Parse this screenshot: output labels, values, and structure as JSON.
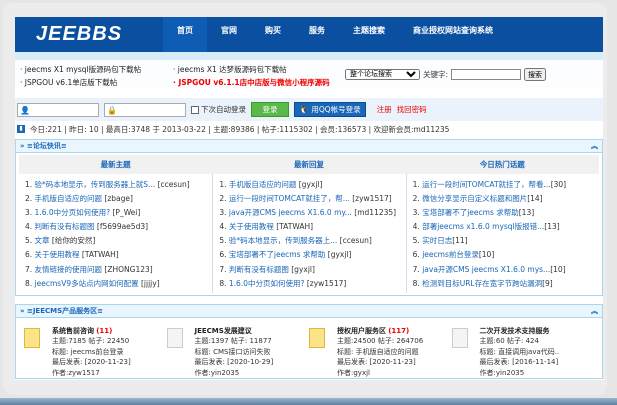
{
  "header": {
    "logo": "JEEBBS",
    "nav": [
      "首页",
      "官网",
      "购买",
      "服务",
      "主题搜索",
      "商业授权网站查询系统"
    ]
  },
  "links": [
    "jeecms X1 mysql版源码包下载帖",
    "JSPGOU v6.1单店版下载帖",
    "jeecms X1 达梦版源码包下载帖",
    "JSPGOU v6.1.1店中店版与微信小程序源码"
  ],
  "search": {
    "scope": "整个论坛搜索",
    "keyword_label": "关键字:",
    "keyword_value": "",
    "button": "搜索"
  },
  "login": {
    "auto_login": "下次自动登录",
    "login_button": "登录",
    "qq_button": "用QQ帐号登录",
    "register": "注册",
    "forgot": "找回密码"
  },
  "stats": "今日:221 | 昨日: 10 | 最高日:3748 于 2013-03-22 | 主题:89386 | 帖子:1115302 | 会员:136573 | 欢迎新会员:md11235",
  "news": {
    "title": "» ≡论坛快讯≡",
    "columns": [
      {
        "title": "最新主题",
        "items": [
          {
            "t": "验*码本地显示，传到服务器上就S...",
            "u": " [ccesun]"
          },
          {
            "t": "手机版自适应的问题",
            "u": " [zbage]"
          },
          {
            "t": "1.6.0中分页如何使用?",
            "u": "  [P_Wei]"
          },
          {
            "t": "判断有没有标题图",
            "u": " [f5699ae5d3]"
          },
          {
            "t": "文章",
            "u": " [给你的安然]"
          },
          {
            "t": "关于使用教程",
            "u": " [TATWAH]"
          },
          {
            "t": "友情链接的使用问题",
            "u": " [ZHONG123]"
          },
          {
            "t": "jeecmsV9多站点内网如何配置",
            "u": " [jjjjy]"
          }
        ]
      },
      {
        "title": "最新回复",
        "items": [
          {
            "t": "手机版自适应的问题",
            "u": " [gyxjl]"
          },
          {
            "t": "运行一段时间TOMCAT就挂了，帮...",
            "u": " [zyw1517]"
          },
          {
            "t": "java开源CMS jeecms X1.6.0 my...",
            "u": " [md11235]"
          },
          {
            "t": "关于使用教程",
            "u": " [TATWAH]"
          },
          {
            "t": "验*码本地显示，传到服务器上...",
            "u": " [ccesun]"
          },
          {
            "t": "宝塔部署不了jeecms 求帮助",
            "u": " [gyxjl]"
          },
          {
            "t": "判断有没有标题图",
            "u": " [gyxjl]"
          },
          {
            "t": "1.6.0中分页如何使用?",
            "u": "  [zyw1517]"
          }
        ]
      },
      {
        "title": "今日热门话题",
        "items": [
          {
            "t": "运行一段时间TOMCAT就挂了，帮看...",
            "u": "[30]"
          },
          {
            "t": "微信分享显示自定义标题和图片",
            "u": "[14]"
          },
          {
            "t": "宝塔部署不了jeecms 求帮助",
            "u": "[13]"
          },
          {
            "t": "部署jeecms x1.6.0 mysql版报错...",
            "u": "[13]"
          },
          {
            "t": "实时日志",
            "u": "[11]"
          },
          {
            "t": "jeecms前台登录",
            "u": "[10]"
          },
          {
            "t": "java开源CMS jeecms X1.6.0 mys...",
            "u": "[10]"
          },
          {
            "t": "检测到目标URL存在宽字节跨站漏洞",
            "u": "[9]"
          }
        ]
      }
    ]
  },
  "products": {
    "title": "» ≡JEECMS产品服务区≡",
    "cards": [
      {
        "name": "系统售前咨询",
        "count": "(11)",
        "new": true,
        "l1": "主题:7185   帖子: 22450",
        "l2": "标题: jeecms前台登录",
        "l3": "最后发表: [2020-11-23]",
        "l4": "作者:zyw1517"
      },
      {
        "name": "JEECMS发展建议",
        "count": "",
        "new": false,
        "l1": "主题:1397   帖子: 11877",
        "l2": "标题: CMS接口访问失败",
        "l3": "最后发表: [2020-10-29]",
        "l4": "作者:yin2035"
      },
      {
        "name": "授权用户服务区",
        "count": "(117)",
        "new": true,
        "l1": "主题:24500   帖子: 264706",
        "l2": "标题: 手机版自适应的问题",
        "l3": "最后发表: [2020-11-23]",
        "l4": "作者:gyxjl"
      },
      {
        "name": "二次开发技术支持服务",
        "count": "",
        "new": false,
        "l1": "主题:60   帖子: 424",
        "l2": "标题: 直接调用java代码..",
        "l3": "最后发表: [2016-11-14]",
        "l4": "作者:yin2035"
      }
    ]
  }
}
